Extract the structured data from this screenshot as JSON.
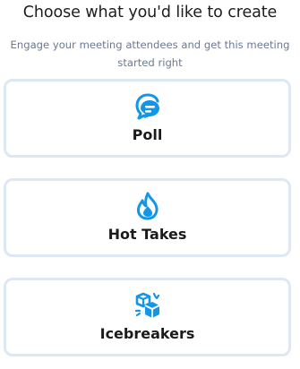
{
  "header": {
    "title": "Choose what you'd like to create",
    "subtitle": "Engage your meeting attendees and get this meeting started right"
  },
  "options": [
    {
      "label": "Poll",
      "icon": "chat-bubbles-icon"
    },
    {
      "label": "Hot Takes",
      "icon": "flame-icon"
    },
    {
      "label": "Icebreakers",
      "icon": "ice-cubes-icon"
    }
  ],
  "colors": {
    "accent": "#1296e8",
    "card_border": "#dde8f4",
    "subtitle": "#6b7a90",
    "title": "#1d1d1f"
  }
}
